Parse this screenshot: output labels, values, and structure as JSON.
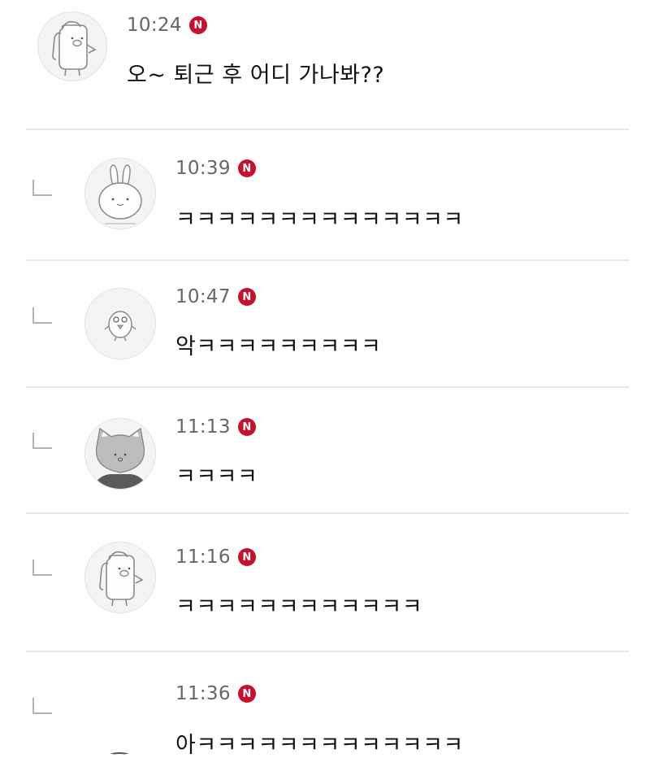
{
  "badge": {
    "label": "N",
    "color": "#c8102e"
  },
  "comments": [
    {
      "time": "10:24",
      "text": "오~ 퇴근 후 어디 가나봐??",
      "is_reply": false,
      "avatar": "pig-character-avatar"
    },
    {
      "time": "10:39",
      "text": "ㅋㅋㅋㅋㅋㅋㅋㅋㅋㅋㅋㅋㅋㅋ",
      "is_reply": true,
      "avatar": "rabbit-character-avatar"
    },
    {
      "time": "10:47",
      "text": "악ㅋㅋㅋㅋㅋㅋㅋㅋㅋ",
      "is_reply": true,
      "avatar": "chick-character-avatar"
    },
    {
      "time": "11:13",
      "text": "ㅋㅋㅋㅋ",
      "is_reply": true,
      "avatar": "cat-character-avatar"
    },
    {
      "time": "11:16",
      "text": "ㅋㅋㅋㅋㅋㅋㅋㅋㅋㅋㅋㅋ",
      "is_reply": true,
      "avatar": "pig-character-avatar"
    },
    {
      "time": "11:36",
      "text": "아ㅋㅋㅋㅋㅋㅋㅋㅋㅋㅋㅋㅋㅋ",
      "is_reply": true,
      "avatar": "blank-avatar"
    }
  ]
}
